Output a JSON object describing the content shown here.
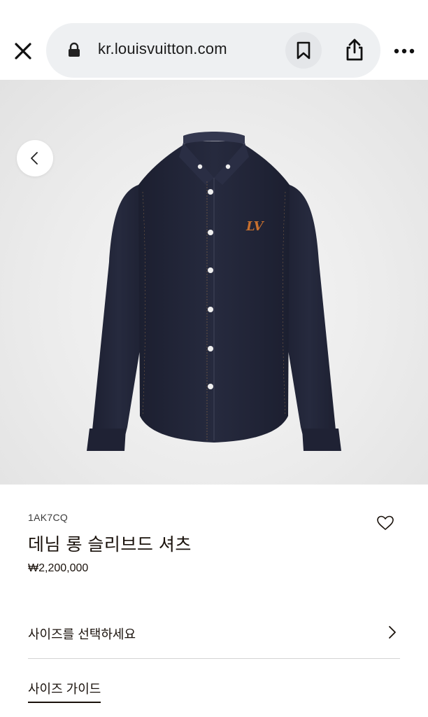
{
  "browser": {
    "url": "kr.louisvuitton.com"
  },
  "product": {
    "sku": "1AK7CQ",
    "title": "데님 롱 슬리브드 셔츠",
    "price": "₩2,200,000"
  },
  "options": {
    "select_size_label": "사이즈를 선택하세요",
    "size_guide_label": "사이즈 가이드"
  },
  "colors": {
    "background": "#ffffff",
    "url_bar": "#eef0f2",
    "hero_background": "#ececec",
    "shirt_denim": "#23263a",
    "logo_orange": "#c8702e",
    "text": "#19110b",
    "divider": "#d4d4d4"
  },
  "icons": [
    "close-icon",
    "lock-icon",
    "bookmark-icon",
    "share-icon",
    "more-icon",
    "chevron-left-icon",
    "heart-icon",
    "chevron-right-icon"
  ]
}
